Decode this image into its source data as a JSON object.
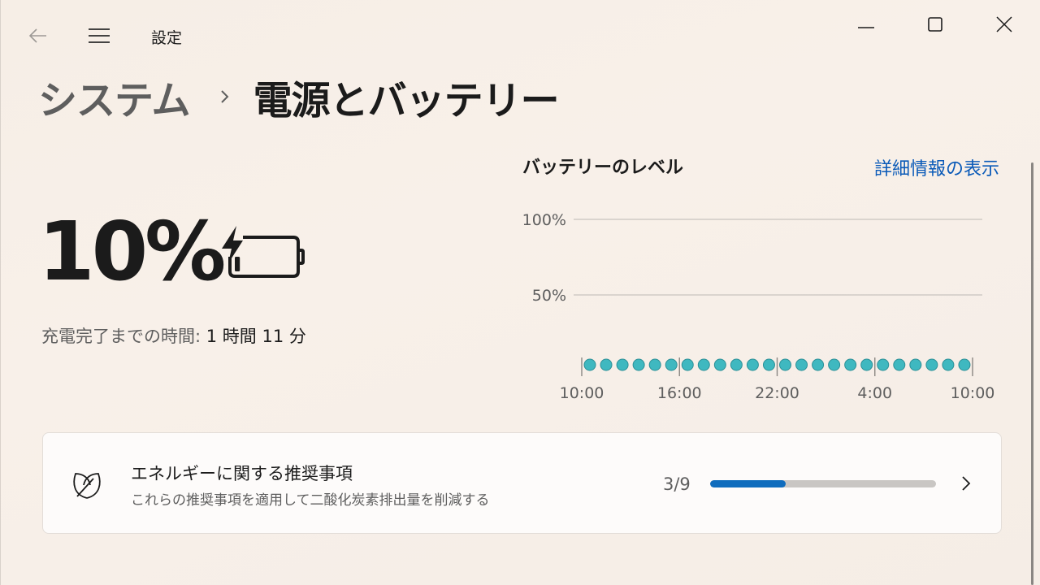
{
  "window": {
    "title": "設定"
  },
  "breadcrumb": {
    "parent": "システム",
    "current": "電源とバッテリー"
  },
  "battery": {
    "percent": "10%",
    "level_fraction": 0.1,
    "charging": true,
    "charge_time_label": "充電完了までの時間:",
    "charge_time_value": "1 時間 11 分"
  },
  "chart_data": {
    "type": "scatter",
    "title": "バッテリーのレベル",
    "ylim": [
      0,
      100
    ],
    "y_ticks": [
      "100%",
      "50%"
    ],
    "y_tick_values": [
      100,
      50
    ],
    "x_ticks": [
      "10:00",
      "16:00",
      "22:00",
      "4:00",
      "10:00"
    ],
    "x_tick_hours": [
      0,
      6,
      12,
      18,
      24
    ],
    "series": [
      {
        "x_hours": [
          0,
          1,
          2,
          3,
          4,
          5,
          6,
          7,
          8,
          9,
          10,
          11,
          12,
          13,
          14,
          15,
          16,
          17,
          18,
          19,
          20,
          21,
          22,
          23
        ],
        "values": [
          0,
          0,
          0,
          0,
          0,
          0,
          0,
          0,
          0,
          0,
          0,
          0,
          0,
          0,
          0,
          0,
          0,
          0,
          0,
          0,
          0,
          0,
          0,
          0
        ]
      }
    ],
    "point_color": "#3fb8c0",
    "grid": true
  },
  "links": {
    "details": "詳細情報の表示"
  },
  "energy_card": {
    "title": "エネルギーに関する推奨事項",
    "subtitle": "これらの推奨事項を適用して二酸化炭素排出量を削減する",
    "count": "3/9",
    "progress_fraction": 0.333
  },
  "colors": {
    "accent": "#0f6cbd",
    "link": "#0a5ab8",
    "chart_point": "#3fb8c0"
  },
  "icons": {
    "back": "back-arrow-icon",
    "menu": "hamburger-menu-icon",
    "minimize": "minimize-icon",
    "maximize": "maximize-icon",
    "close": "close-icon",
    "battery": "battery-charging-icon",
    "leaf": "leaf-icon",
    "chevron": "chevron-right-icon"
  }
}
